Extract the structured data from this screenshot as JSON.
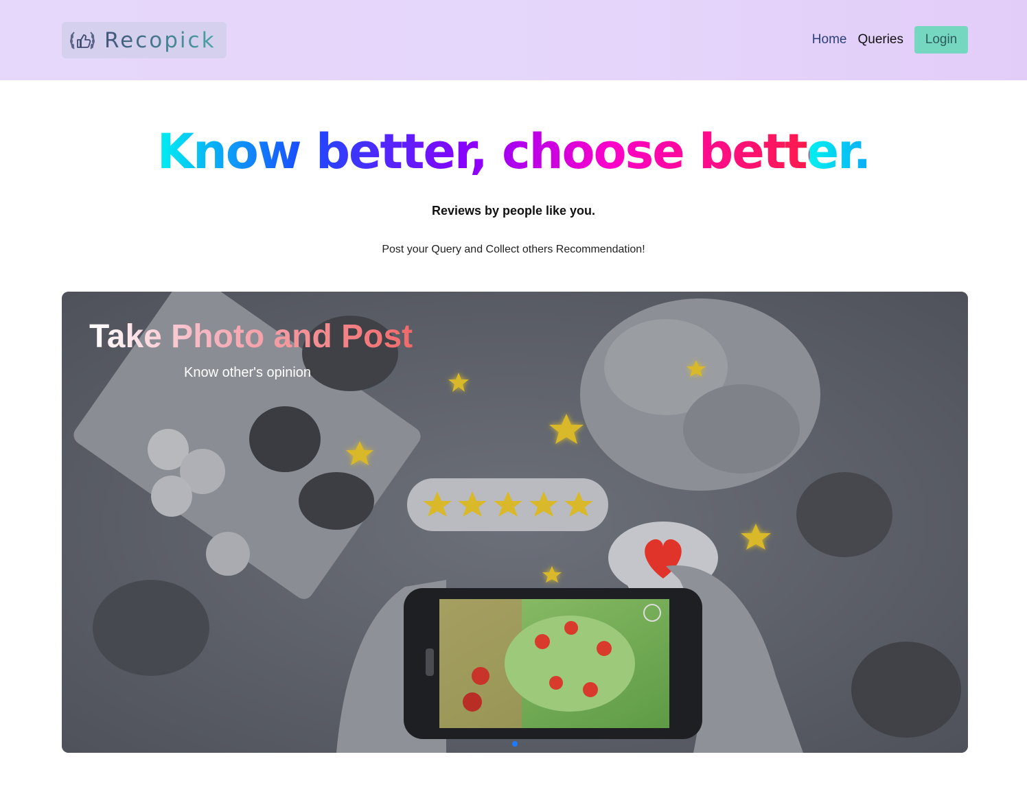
{
  "brand": {
    "name": "Recopick",
    "logo_icon": "thumbs-up-laurel-icon"
  },
  "nav": {
    "home": "Home",
    "queries": "Queries",
    "login": "Login"
  },
  "hero": {
    "title": "Know better, choose better.",
    "tagline": "Reviews by people like you.",
    "subline": "Post your Query and Collect others Recommendation!"
  },
  "carousel": {
    "slides": [
      {
        "title": "Take Photo and Post",
        "subtitle": "Know other's opinion"
      }
    ],
    "active_index": 0,
    "rating_stars": 5
  },
  "colors": {
    "navbar_bg": "#e5d5fb",
    "login_bg": "#75d7bf",
    "indicator": "#1e7bff"
  }
}
